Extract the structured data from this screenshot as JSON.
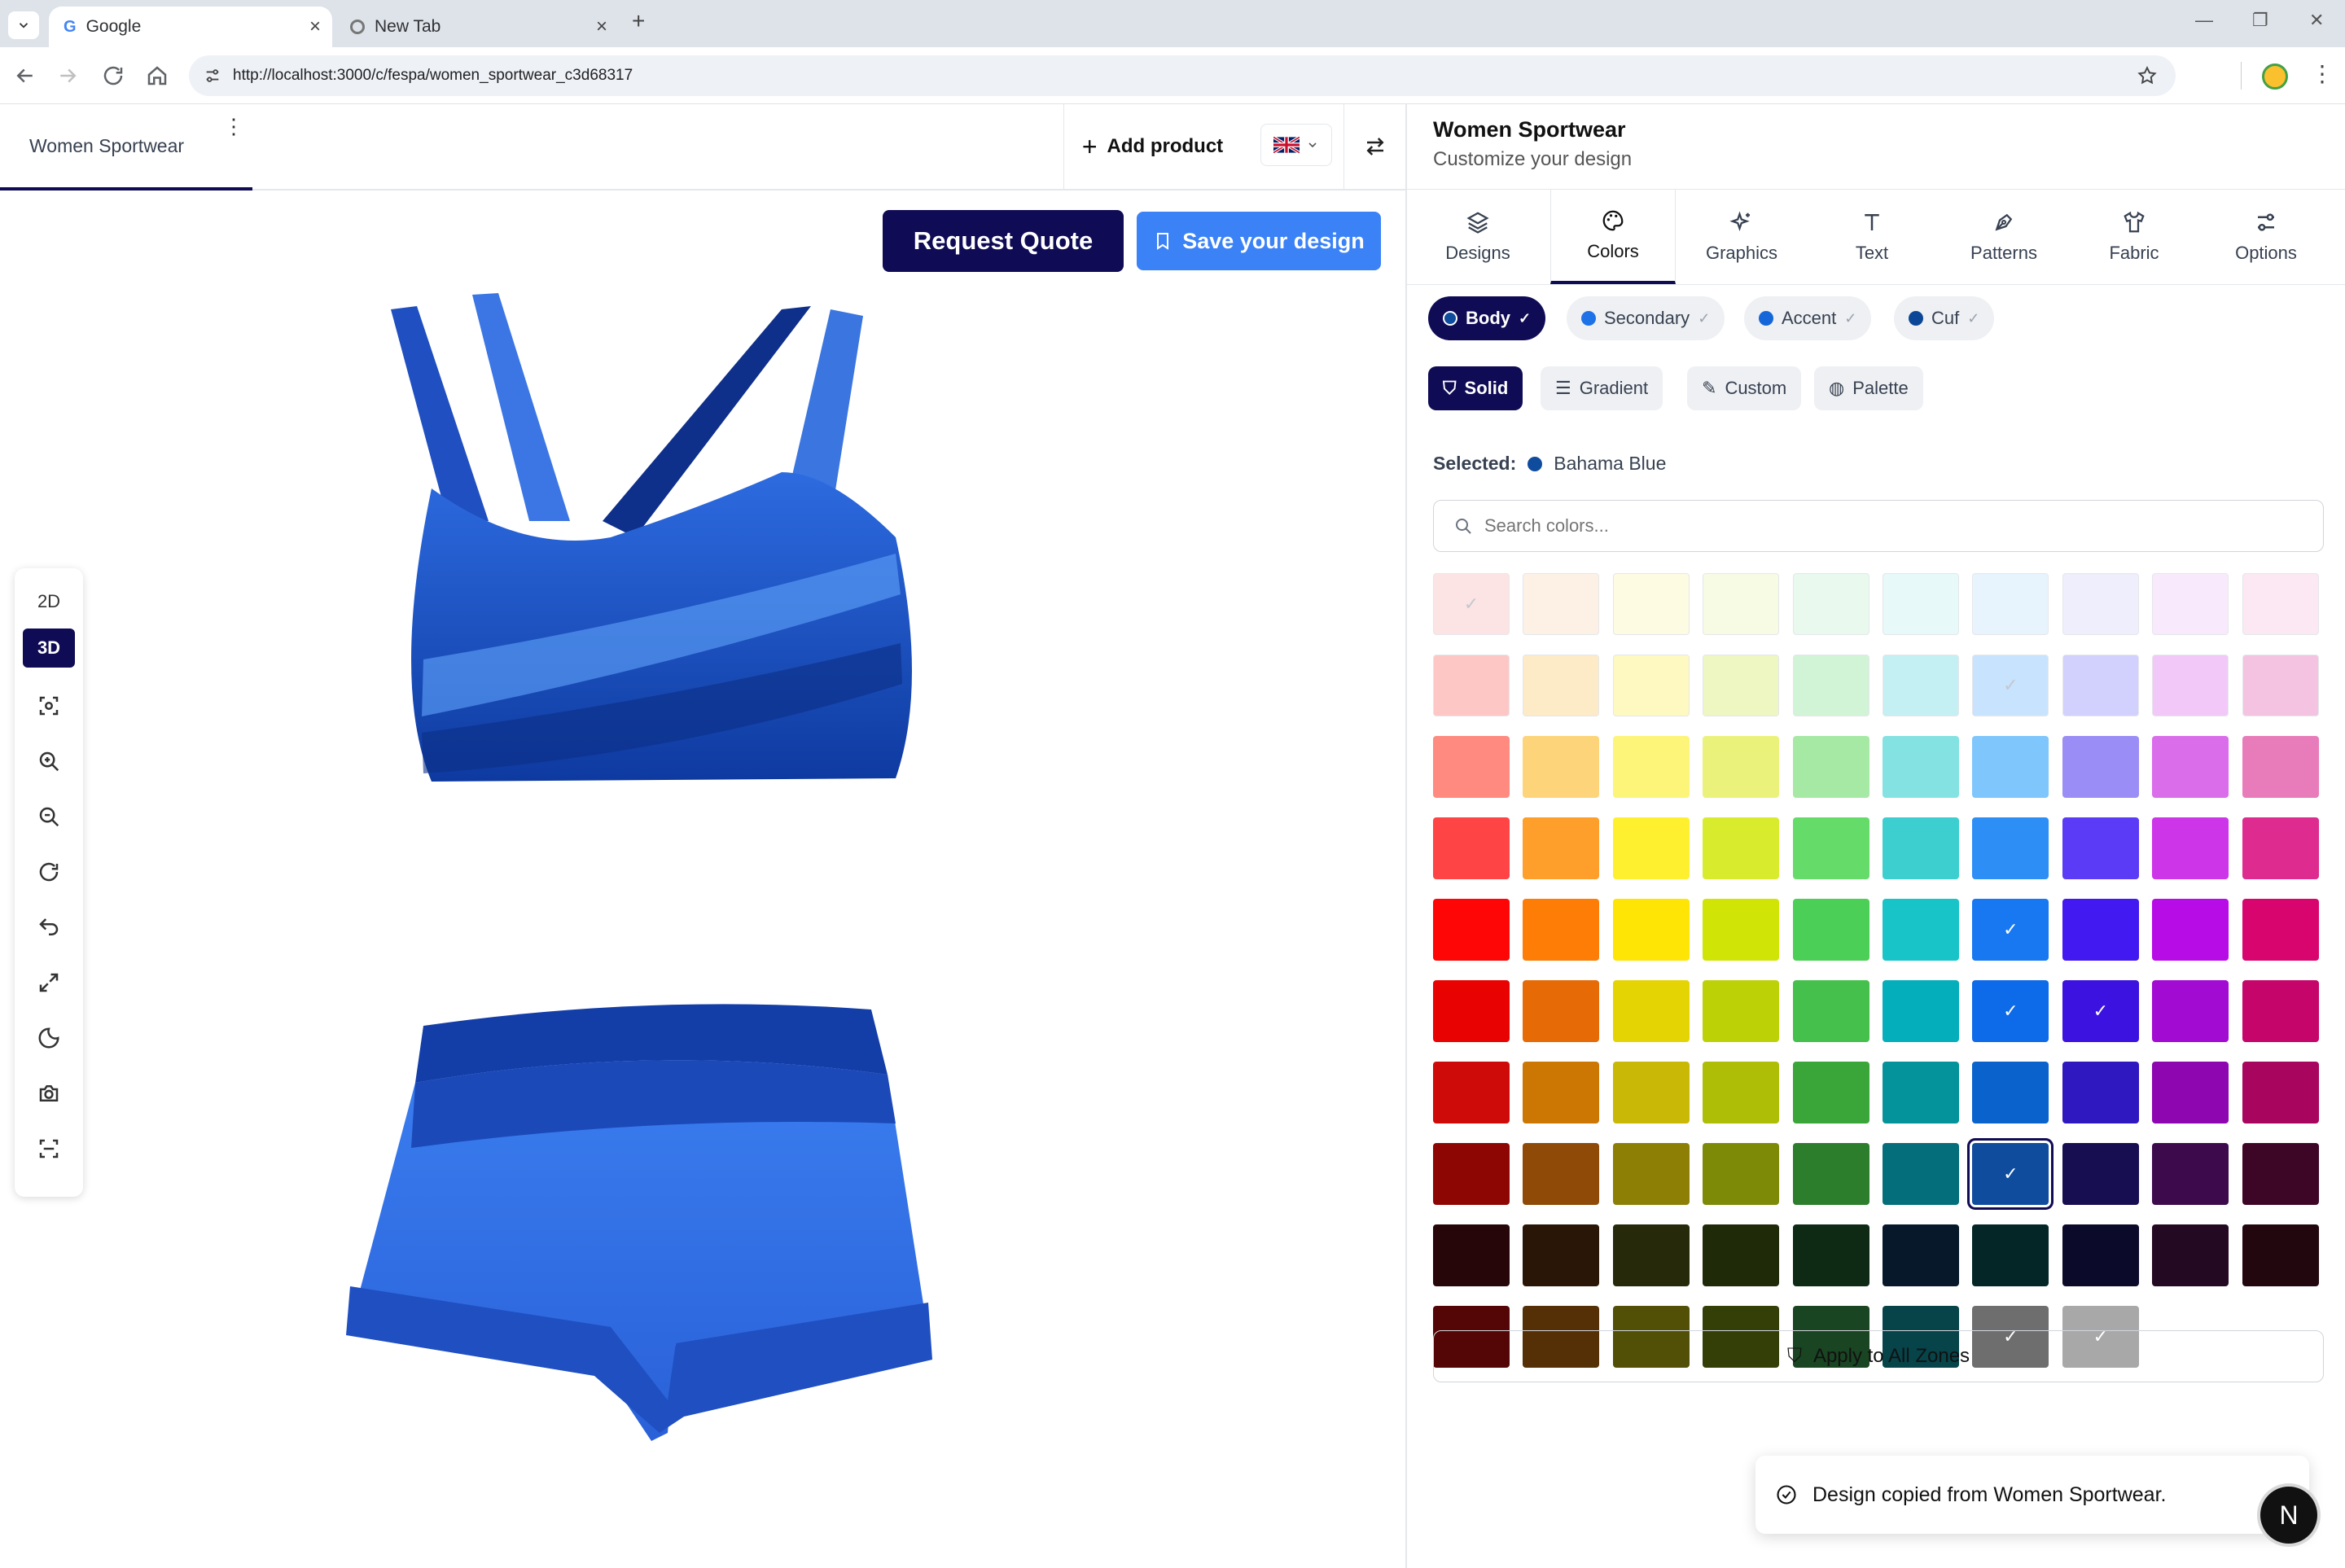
{
  "browser": {
    "tabs": [
      {
        "title": "Google",
        "active": true
      },
      {
        "title": "New Tab",
        "active": false
      }
    ],
    "new_tab": "+",
    "url": "http://localhost:3000/c/fespa/women_sportwear_c3d68317"
  },
  "header": {
    "project_tab": "Women Sportwear",
    "add_product": "Add product",
    "language": "GB"
  },
  "canvas": {
    "request_quote": "Request Quote",
    "save_design": "Save your design",
    "view_2d": "2D",
    "view_3d": "3D",
    "active_view": "3D",
    "garment_color": "#2d6be0"
  },
  "panel": {
    "title": "Women Sportwear",
    "subtitle": "Customize your design",
    "tabs": [
      {
        "label": "Designs",
        "icon": "layers-icon"
      },
      {
        "label": "Colors",
        "icon": "palette-icon"
      },
      {
        "label": "Graphics",
        "icon": "sparkles-icon"
      },
      {
        "label": "Text",
        "icon": "text-icon"
      },
      {
        "label": "Patterns",
        "icon": "pen-tool-icon"
      },
      {
        "label": "Fabric",
        "icon": "shirt-icon"
      },
      {
        "label": "Options",
        "icon": "sliders-icon"
      }
    ],
    "active_tab": "Colors",
    "zones": [
      {
        "label": "Body",
        "color": "#0f4c9e",
        "active": true
      },
      {
        "label": "Secondary",
        "color": "#1d72e8",
        "active": false
      },
      {
        "label": "Accent",
        "color": "#1566d8",
        "active": false
      },
      {
        "label": "Cuf",
        "color": "#0b4796",
        "active": false
      }
    ],
    "modes": [
      {
        "label": "Solid",
        "active": true
      },
      {
        "label": "Gradient",
        "active": false
      },
      {
        "label": "Custom",
        "active": false
      },
      {
        "label": "Palette",
        "active": false
      }
    ],
    "selected_label": "Selected:",
    "selected_name": "Bahama Blue",
    "selected_color": "#0f4c9e",
    "search_placeholder": "Search colors...",
    "apply_all": "Apply to All Zones"
  },
  "palette": [
    [
      {
        "c": "#fde4e4",
        "check": true
      },
      {
        "c": "#fdf1e6"
      },
      {
        "c": "#fefbe3"
      },
      {
        "c": "#f8fbe4"
      },
      {
        "c": "#e9f9ee"
      },
      {
        "c": "#e7f9f9"
      },
      {
        "c": "#e7f4fd"
      },
      {
        "c": "#eeeefc"
      },
      {
        "c": "#f8eafc"
      },
      {
        "c": "#fbe8f2"
      }
    ],
    [
      {
        "c": "#fdc7c6"
      },
      {
        "c": "#fcebc6"
      },
      {
        "c": "#fdf9c0"
      },
      {
        "c": "#eef7c2"
      },
      {
        "c": "#d1f3d6"
      },
      {
        "c": "#c4eff3"
      },
      {
        "c": "#c7e3fd",
        "check": true
      },
      {
        "c": "#d2d0fc"
      },
      {
        "c": "#f1c8f7"
      },
      {
        "c": "#f4c3e2"
      }
    ],
    [
      {
        "c": "#fe8a80"
      },
      {
        "c": "#fdd47a"
      },
      {
        "c": "#fdf47a"
      },
      {
        "c": "#ebf27c"
      },
      {
        "c": "#a6e9a4"
      },
      {
        "c": "#85e2e2"
      },
      {
        "c": "#7ec6fb"
      },
      {
        "c": "#9a8df6"
      },
      {
        "c": "#da6eea"
      },
      {
        "c": "#e87cba"
      }
    ],
    [
      {
        "c": "#fe4444"
      },
      {
        "c": "#fe9e2b"
      },
      {
        "c": "#fef02e"
      },
      {
        "c": "#d8ec2d"
      },
      {
        "c": "#65dc6a"
      },
      {
        "c": "#3dcfd0"
      },
      {
        "c": "#2d8ff6"
      },
      {
        "c": "#5b3bf6"
      },
      {
        "c": "#cd35e8"
      },
      {
        "c": "#dd2b90"
      }
    ],
    [
      {
        "c": "#fe0605"
      },
      {
        "c": "#fe7d06"
      },
      {
        "c": "#fee506"
      },
      {
        "c": "#d0e506"
      },
      {
        "c": "#4ccf56"
      },
      {
        "c": "#18c4c8"
      },
      {
        "c": "#1778f2",
        "check": true
      },
      {
        "c": "#4219f0"
      },
      {
        "c": "#b80ce6"
      },
      {
        "c": "#d8056e"
      }
    ],
    [
      {
        "c": "#e80302"
      },
      {
        "c": "#e66a06"
      },
      {
        "c": "#e5d404"
      },
      {
        "c": "#bdd206"
      },
      {
        "c": "#45c04c"
      },
      {
        "c": "#04aebb"
      },
      {
        "c": "#0d6ae8",
        "check": true
      },
      {
        "c": "#3c12e0",
        "check": true
      },
      {
        "c": "#a20bd2"
      },
      {
        "c": "#c5056a"
      }
    ],
    [
      {
        "c": "#ce0b08"
      },
      {
        "c": "#cc7704"
      },
      {
        "c": "#cab806"
      },
      {
        "c": "#aebd06"
      },
      {
        "c": "#3aa639"
      },
      {
        "c": "#04939a"
      },
      {
        "c": "#0a63cc"
      },
      {
        "c": "#2f18c0"
      },
      {
        "c": "#8d06b0"
      },
      {
        "c": "#a8055e"
      }
    ],
    [
      {
        "c": "#8e0604"
      },
      {
        "c": "#8e4a06"
      },
      {
        "c": "#8d7f06"
      },
      {
        "c": "#7d8a08"
      },
      {
        "c": "#2c7d2c"
      },
      {
        "c": "#046e7a"
      },
      {
        "c": "#0f4c9e",
        "check": true,
        "selected": true
      },
      {
        "c": "#170e52"
      },
      {
        "c": "#3d0a4c"
      },
      {
        "c": "#3e0626"
      }
    ],
    [
      {
        "c": "#260608"
      },
      {
        "c": "#2a1606"
      },
      {
        "c": "#272a0a"
      },
      {
        "c": "#1f2a08"
      },
      {
        "c": "#0e2a14"
      },
      {
        "c": "#06182a"
      },
      {
        "c": "#042626"
      },
      {
        "c": "#0c0a2a"
      },
      {
        "c": "#230a22"
      },
      {
        "c": "#23070f"
      }
    ],
    [
      {
        "c": "#540606"
      },
      {
        "c": "#553006"
      },
      {
        "c": "#525006"
      },
      {
        "c": "#343f08"
      },
      {
        "c": "#1a4523"
      },
      {
        "c": "#06444a"
      },
      {
        "c": "#6e6e6e",
        "check": true
      },
      {
        "c": "#a8a8a8",
        "check": true
      }
    ]
  ],
  "toast": {
    "message": "Design copied from Women Sportwear.",
    "n_button": "N"
  }
}
